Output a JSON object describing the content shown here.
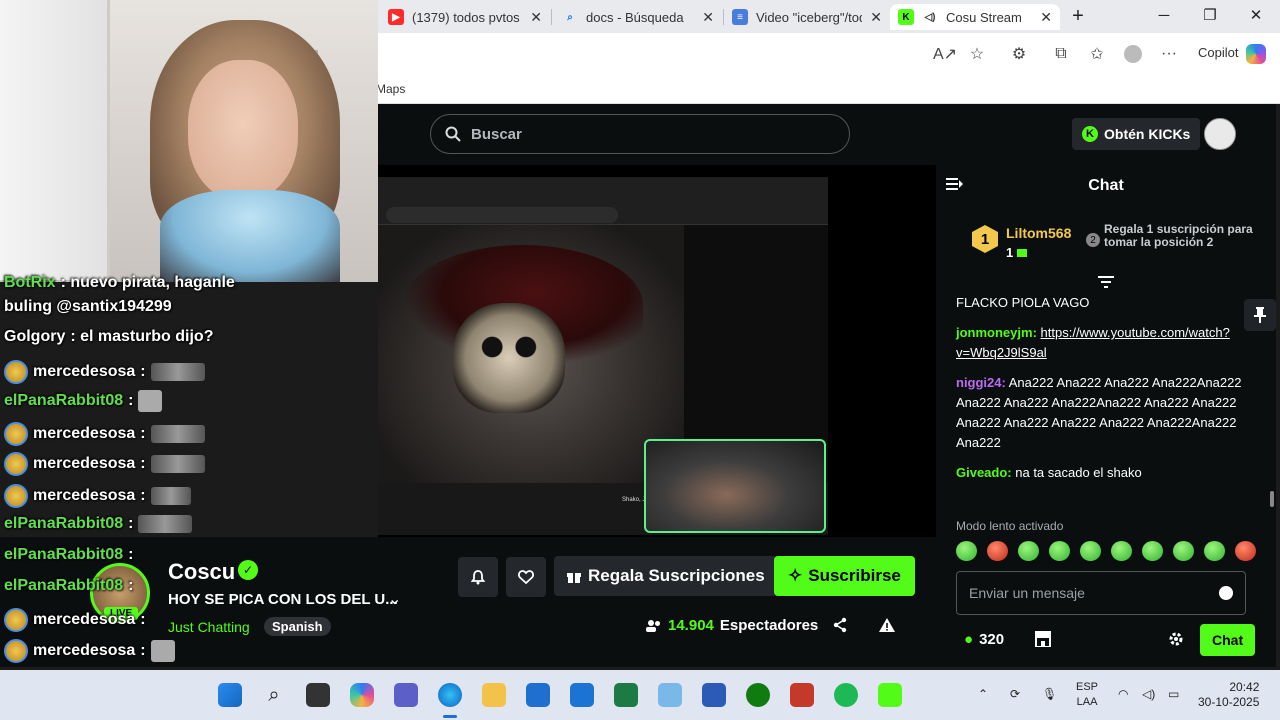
{
  "browser": {
    "tabs": [
      {
        "title": "(1379) todos pvtos -",
        "icon": "youtube-icon"
      },
      {
        "title": "docs - Búsqueda",
        "icon": "search-icon"
      },
      {
        "title": "Video \"iceberg\"/tod",
        "icon": "doc-icon"
      },
      {
        "title": "Cosu Stream - ",
        "icon": "kick-icon"
      }
    ],
    "copilot_label": "Copilot",
    "favorites_label": "Maps"
  },
  "kick": {
    "search_placeholder": "Buscar",
    "get_kicks": "Obtén KICKs",
    "video_caption": "Shako, Jugo! - Medio Tana (Video Oficial)"
  },
  "overlay_chat": [
    {
      "name": "BotRix",
      "text": ": nuevo pirata, haganle",
      "color": "#5fe04c"
    },
    {
      "name": "",
      "text": "buling @santix194299",
      "color": "#ffffff"
    },
    {
      "name": "Golgory",
      "text": ": el masturbo dijo?",
      "color": "#ffffff"
    },
    {
      "name": "mercedesosa",
      "text": ":",
      "color": "#ffffff"
    },
    {
      "name": "elPanaRabbit08",
      "text": ":",
      "color": "#5fe04c"
    },
    {
      "name": "mercedesosa",
      "text": ":",
      "color": "#ffffff"
    },
    {
      "name": "mercedesosa",
      "text": ":",
      "color": "#ffffff"
    },
    {
      "name": "mercedesosa",
      "text": ":",
      "color": "#ffffff"
    },
    {
      "name": "elPanaRabbit08",
      "text": ":",
      "color": "#5fe04c"
    },
    {
      "name": "elPanaRabbit08",
      "text": ":",
      "color": "#5fe04c"
    },
    {
      "name": "elPanaRabbit08",
      "text": ":",
      "color": "#5fe04c"
    },
    {
      "name": "mercedesosa",
      "text": ":",
      "color": "#ffffff"
    },
    {
      "name": "mercedesosa",
      "text": ":",
      "color": "#ffffff"
    },
    {
      "name": "mercedesosa",
      "text": ":",
      "color": "#ffffff"
    },
    {
      "name": "mercedesosa",
      "text": ":",
      "color": "#ffffff"
    }
  ],
  "stream": {
    "streamer": "Coscu",
    "live_badge": "LIVE",
    "title": "HOY SE PICA CON LOS DEL U...",
    "category": "Just Chatting",
    "language": "Spanish",
    "gift_label": "Regala Suscripciones",
    "subscribe_label": "Suscribirse",
    "viewers": "14.904",
    "viewers_label": "Espectadores"
  },
  "chat": {
    "title": "Chat",
    "leader": {
      "rank": "1",
      "name": "Liltom568",
      "count": "1"
    },
    "next_rank": "2",
    "cta": "Regala 1 suscripción para tomar la posición 2",
    "messages": [
      {
        "user": "",
        "text": "FLACKO PIOLA VAGO",
        "color": "#ffffff"
      },
      {
        "user": "jonmoneyjm:",
        "text": "https://www.youtube.com/watch?v=Wbq2J9lS9al",
        "color": "#53fc18",
        "link": true
      },
      {
        "user": "niggi24:",
        "text": "Ana222 Ana222 Ana222 Ana222Ana222 Ana222 Ana222 Ana222Ana222 Ana222 Ana222 Ana222 Ana222 Ana222 Ana222 Ana222Ana222 Ana222",
        "color": "#b86cf0"
      },
      {
        "user": "Giveado:",
        "text": "na ta sacado el shako",
        "color": "#53fc18"
      }
    ],
    "slow_mode": "Modo lento activado",
    "input_placeholder": "Enviar un mensaje",
    "points": "320",
    "send_label": "Chat"
  },
  "taskbar": {
    "lang": "ESP",
    "lang2": "LAA",
    "time": "20:42",
    "date": "30-10-2025"
  },
  "colors": {
    "kick_green": "#53fc18",
    "kick_bg": "#0b0e0f"
  }
}
